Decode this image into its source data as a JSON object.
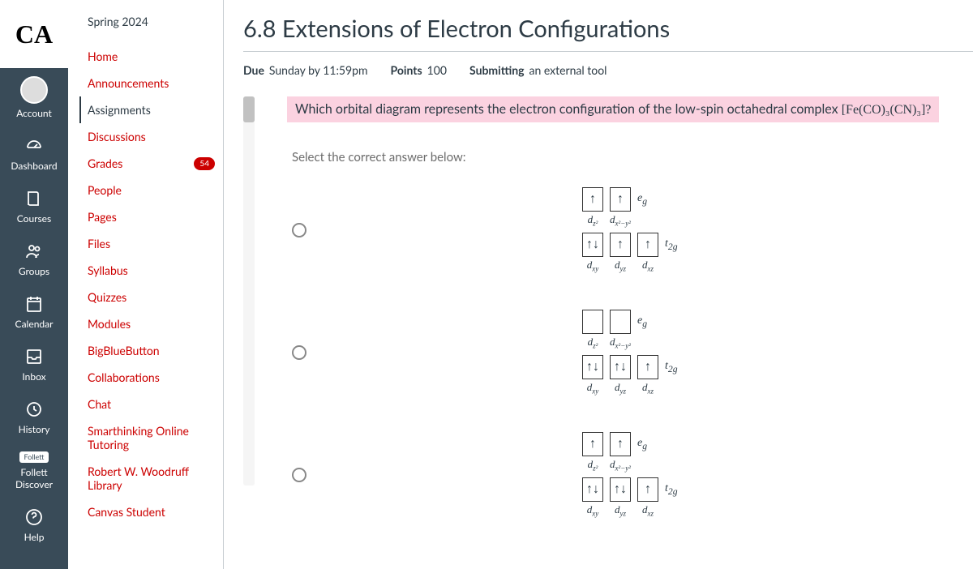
{
  "global_nav": {
    "logo": "CA",
    "items": [
      {
        "label": "Account",
        "icon": "avatar"
      },
      {
        "label": "Dashboard",
        "icon": "dashboard"
      },
      {
        "label": "Courses",
        "icon": "courses"
      },
      {
        "label": "Groups",
        "icon": "groups"
      },
      {
        "label": "Calendar",
        "icon": "calendar"
      },
      {
        "label": "Inbox",
        "icon": "inbox"
      },
      {
        "label": "History",
        "icon": "history"
      },
      {
        "label": "Follett Discover",
        "icon": "follett",
        "sub": "Follett"
      },
      {
        "label": "Help",
        "icon": "help"
      }
    ]
  },
  "course_nav": {
    "term": "Spring 2024",
    "items": [
      {
        "label": "Home"
      },
      {
        "label": "Announcements"
      },
      {
        "label": "Assignments",
        "active": true
      },
      {
        "label": "Discussions"
      },
      {
        "label": "Grades",
        "badge": "54"
      },
      {
        "label": "People"
      },
      {
        "label": "Pages"
      },
      {
        "label": "Files"
      },
      {
        "label": "Syllabus"
      },
      {
        "label": "Quizzes"
      },
      {
        "label": "Modules"
      },
      {
        "label": "BigBlueButton"
      },
      {
        "label": "Collaborations"
      },
      {
        "label": "Chat"
      },
      {
        "label": "Smarthinking Online Tutoring"
      },
      {
        "label": "Robert W. Woodruff Library"
      },
      {
        "label": "Canvas Student"
      }
    ]
  },
  "page": {
    "title": "6.8 Extensions of Electron Configurations",
    "due_label": "Due",
    "due_value": "Sunday by 11:59pm",
    "points_label": "Points",
    "points_value": "100",
    "submitting_label": "Submitting",
    "submitting_value": "an external tool"
  },
  "question": {
    "text_prefix": "Which orbital diagram represents the electron configuration of the low-spin octahedral complex ",
    "formula": "[Fe(CO)₃(CN)₃]?",
    "prompt": "Select the correct answer below:"
  },
  "answers": [
    {
      "eg": [
        {
          "fill": "↑",
          "label": "d_z²"
        },
        {
          "fill": "↑",
          "label": "d_x²−y²"
        }
      ],
      "t2g": [
        {
          "fill": "↑↓",
          "label": "d_xy"
        },
        {
          "fill": "↑",
          "label": "d_yz"
        },
        {
          "fill": "↑",
          "label": "d_xz"
        }
      ]
    },
    {
      "eg": [
        {
          "fill": "",
          "label": "d_z²"
        },
        {
          "fill": "",
          "label": "d_x²−y²"
        }
      ],
      "t2g": [
        {
          "fill": "↑↓",
          "label": "d_xy"
        },
        {
          "fill": "↑↓",
          "label": "d_yz"
        },
        {
          "fill": "↑",
          "label": "d_xz"
        }
      ]
    },
    {
      "eg": [
        {
          "fill": "↑",
          "label": "d_z²"
        },
        {
          "fill": "↑",
          "label": "d_x²−y²"
        }
      ],
      "t2g": [
        {
          "fill": "↑↓",
          "label": "d_xy"
        },
        {
          "fill": "↑↓",
          "label": "d_yz"
        },
        {
          "fill": "↑",
          "label": "d_xz"
        }
      ]
    }
  ],
  "labels": {
    "eg": "e_g",
    "t2g": "t_2g"
  }
}
